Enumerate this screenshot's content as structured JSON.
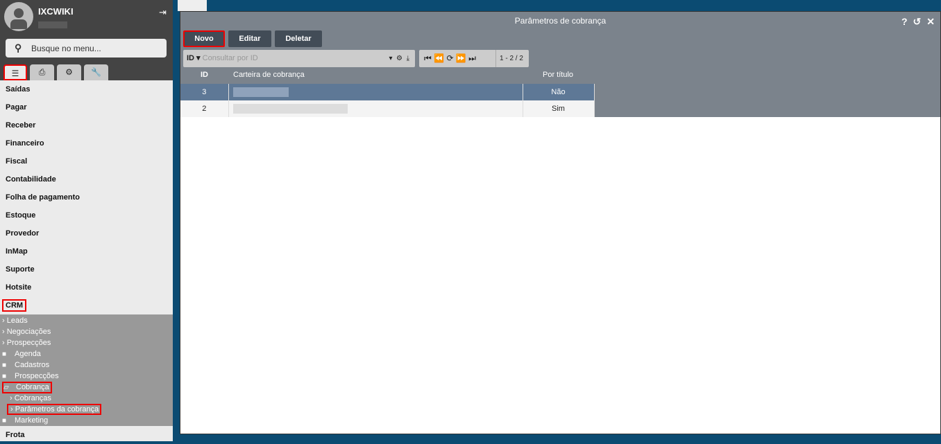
{
  "sidebar": {
    "username": "IXCWIKI",
    "search_placeholder": "Busque no menu...",
    "menu": [
      "Saídas",
      "Pagar",
      "Receber",
      "Financeiro",
      "Fiscal",
      "Contabilidade",
      "Folha de pagamento",
      "Estoque",
      "Provedor",
      "InMap",
      "Suporte",
      "Hotsite"
    ],
    "crm": "CRM",
    "crm_sub": [
      "Leads",
      "Negociações",
      "Prospecções"
    ],
    "folders": [
      "Agenda",
      "Cadastros",
      "Prospecções"
    ],
    "cobranca": "Cobrança",
    "cobranca_sub": [
      "Cobranças",
      "Parâmetros da cobrança"
    ],
    "marketing": "Marketing",
    "frota": "Frota"
  },
  "modal": {
    "title": "Parâmetros de cobrança",
    "buttons": {
      "new": "Novo",
      "edit": "Editar",
      "delete": "Deletar"
    },
    "query": {
      "field": "ID",
      "placeholder": "Consultar por ID"
    },
    "pager": {
      "count": "1 - 2 / 2"
    },
    "columns": [
      "ID",
      "Carteira de cobrança",
      "Por título"
    ],
    "rows": [
      {
        "id": "3",
        "por_titulo": "Não"
      },
      {
        "id": "2",
        "por_titulo": "Sim"
      }
    ]
  }
}
